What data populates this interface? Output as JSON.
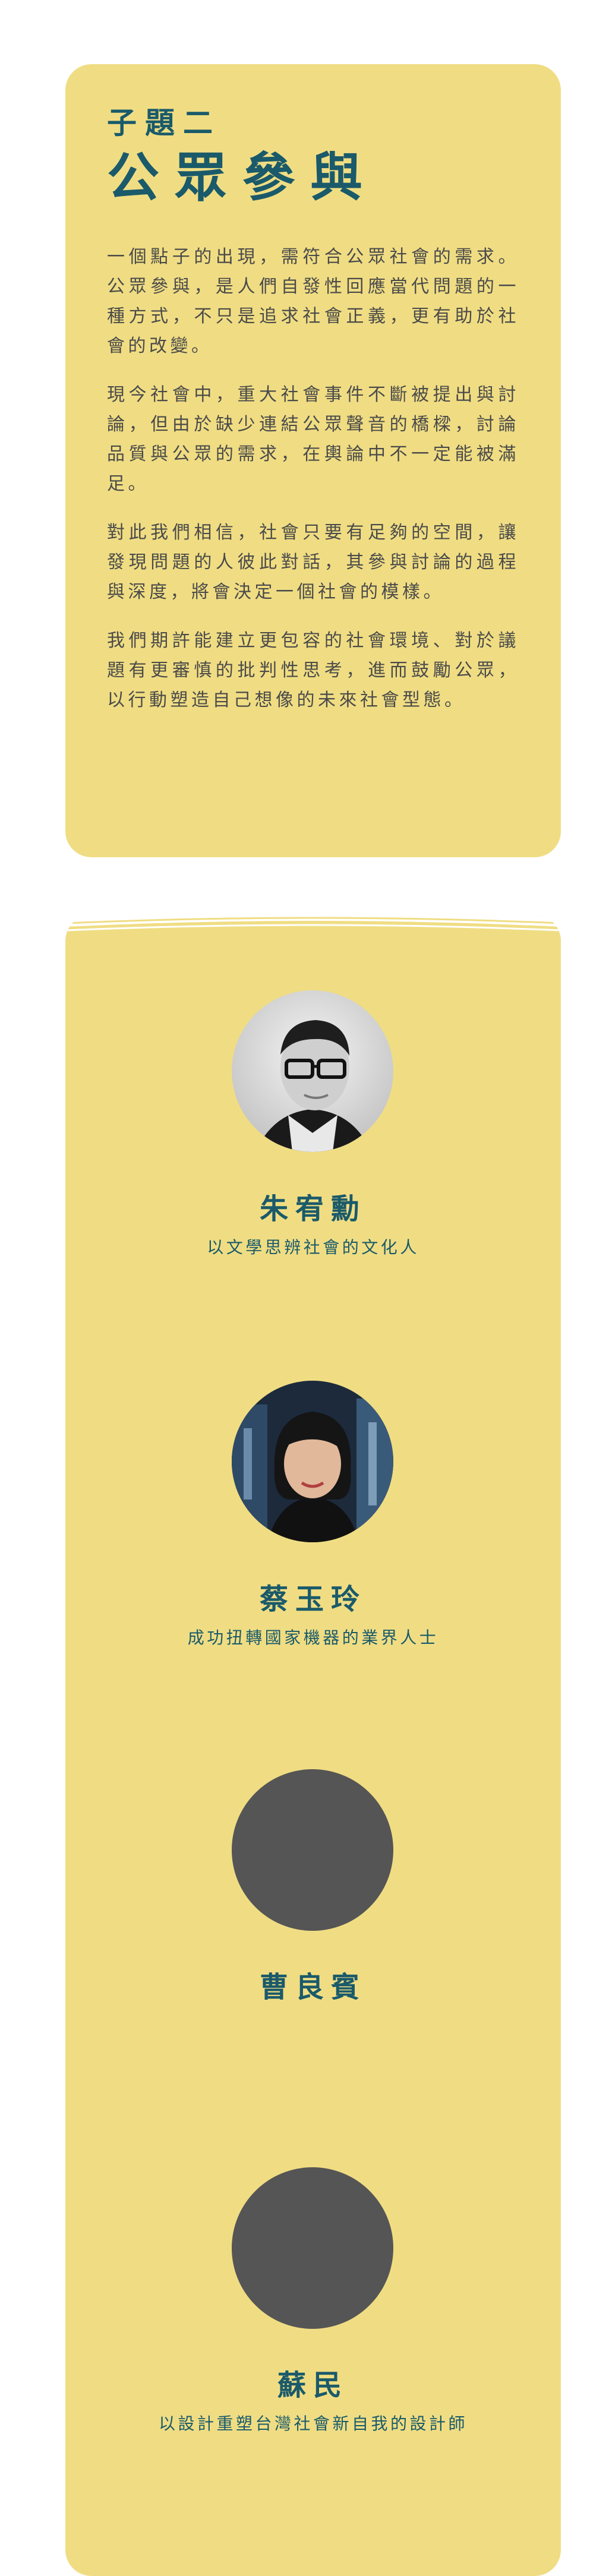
{
  "topic": {
    "subtitle": "子題二",
    "title": "公眾參與",
    "paragraphs": [
      "一個點子的出現，需符合公眾社會的需求。公眾參與，是人們自發性回應當代問題的一種方式，不只是追求社會正義，更有助於社會的改變。",
      "現今社會中，重大社會事件不斷被提出與討論，但由於缺少連結公眾聲音的橋樑，討論品質與公眾的需求，在輿論中不一定能被滿足。",
      "對此我們相信，社會只要有足夠的空間，讓發現問題的人彼此對話，其參與討論的過程與深度，將會決定一個社會的模樣。",
      "我們期許能建立更包容的社會環境、對於議題有更審慎的批判性思考，進而鼓勵公眾，以行動塑造自己想像的未來社會型態。"
    ]
  },
  "speakers": [
    {
      "name": "朱宥勳",
      "role": "以文學思辨社會的文化人",
      "photo": "portrait-bw-man-glasses"
    },
    {
      "name": "蔡玉玲",
      "role": "成功扭轉國家機器的業界人士",
      "photo": "portrait-woman-dark-hair"
    },
    {
      "name": "曹良賓",
      "role": "",
      "photo": "placeholder"
    },
    {
      "name": "蘇民",
      "role": "以設計重塑台灣社會新自我的設計師",
      "photo": "placeholder"
    }
  ],
  "colors": {
    "card_bg": "#f0dd83",
    "accent": "#1a5a6a",
    "body_text": "#4a4a4a",
    "placeholder": "#555555"
  }
}
